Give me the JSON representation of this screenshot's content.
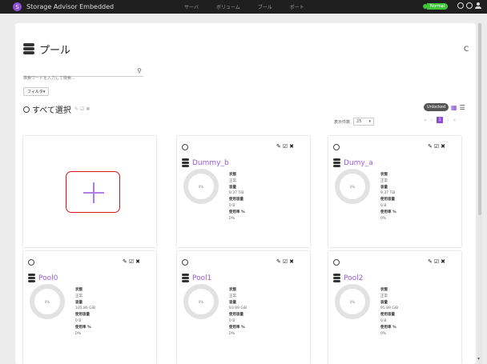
{
  "app": {
    "title": "Storage Advisor Embedded",
    "logo_letter": "S"
  },
  "nav": [
    "サーバ",
    "ボリューム",
    "プール",
    "ポート"
  ],
  "status": {
    "label": "Normal",
    "color": "#3fc63a"
  },
  "page": {
    "title": "プール",
    "search_placeholder": "検索ワードを入力して検索...",
    "filter_label": "フィルタ▾",
    "select_all": "すべて選択",
    "unlocked_badge": "Unlocked",
    "per_page_label": "表示件数",
    "per_page_value": "25",
    "current_page": "1"
  },
  "labels": {
    "status": "状態",
    "capacity": "容量",
    "used": "使用容量",
    "usage": "使用率 %"
  },
  "pools": [
    {
      "name": "Dummy_b",
      "usage_pct": "0%",
      "status": "正常",
      "capacity": "9.37 TiB",
      "used": "0 B",
      "usage": "0%"
    },
    {
      "name": "Dumy_a",
      "usage_pct": "0%",
      "status": "正常",
      "capacity": "9.37 TiB",
      "used": "0 B",
      "usage": "0%"
    },
    {
      "name": "Pool0",
      "usage_pct": "0%",
      "status": "正常",
      "capacity": "105.86 GiB",
      "used": "0 B",
      "usage": "0%"
    },
    {
      "name": "Pool1",
      "usage_pct": "0%",
      "status": "正常",
      "capacity": "93.89 GiB",
      "used": "0 B",
      "usage": "0%"
    },
    {
      "name": "Pool2",
      "usage_pct": "0%",
      "status": "正常",
      "capacity": "95.89 GiB",
      "used": "0 B",
      "usage": "0%"
    }
  ],
  "colors": {
    "accent": "#8e4fd8",
    "pool_name": "#9b59e0",
    "add_highlight": "#d9141e"
  }
}
